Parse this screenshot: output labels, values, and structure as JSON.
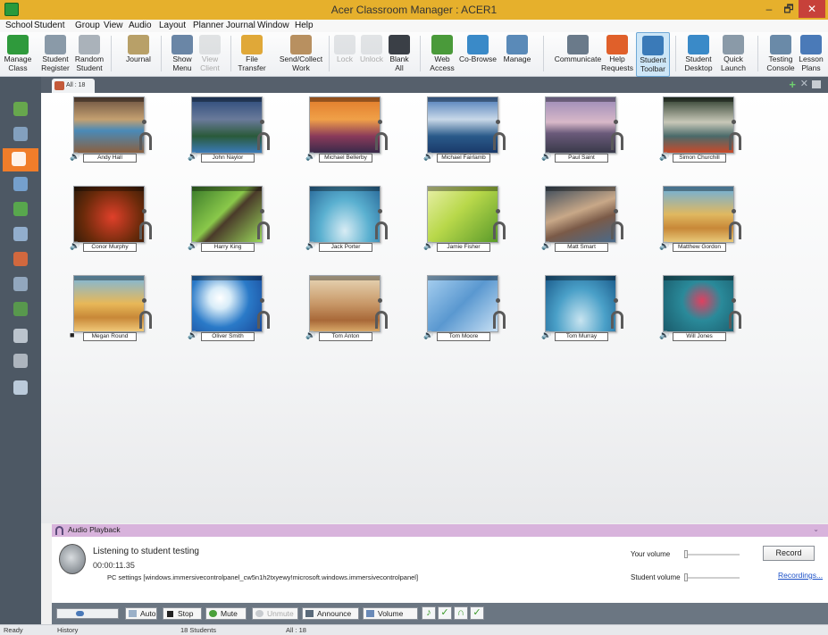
{
  "window": {
    "title": "Acer Classroom Manager : ACER1",
    "min": "–",
    "max": "🗗",
    "close": "✕"
  },
  "menu": [
    "School",
    "Student",
    "Group",
    "View",
    "Audio",
    "Layout",
    "Planner",
    "Journal",
    "Window",
    "Help"
  ],
  "ribbon": [
    {
      "label": "Manage\nClass",
      "icon": "manage-class-icon",
      "color": "#2f9a3c",
      "enabled": true
    },
    {
      "label": "Student\nRegister",
      "icon": "student-register-icon",
      "color": "#8a9aa8",
      "enabled": true
    },
    {
      "label": "Random\nStudent",
      "icon": "dice-icon",
      "color": "#aab2ba",
      "enabled": true
    },
    {
      "label": "Journal",
      "icon": "journal-icon",
      "color": "#b8a068",
      "enabled": true
    },
    {
      "label": "Show\nMenu",
      "icon": "show-icon",
      "color": "#6a86a6",
      "enabled": true
    },
    {
      "label": "View\nClient",
      "icon": "view-client-icon",
      "color": "#c6c9cc",
      "enabled": false
    },
    {
      "label": "File\nTransfer",
      "icon": "file-transfer-icon",
      "color": "#e0a838",
      "enabled": true
    },
    {
      "label": "Send/Collect\nWork",
      "icon": "send-collect-icon",
      "color": "#b89060",
      "enabled": true
    },
    {
      "label": "Lock",
      "icon": "lock-icon",
      "color": "#c8cbcf",
      "enabled": false
    },
    {
      "label": "Unlock",
      "icon": "unlock-icon",
      "color": "#c8cbcf",
      "enabled": false
    },
    {
      "label": "Blank\nAll",
      "icon": "blank-all-icon",
      "color": "#3a3f46",
      "enabled": true
    },
    {
      "label": "Web\nAccess",
      "icon": "web-access-icon",
      "color": "#4a9a3a",
      "enabled": true
    },
    {
      "label": "Co-Browse",
      "icon": "co-browse-icon",
      "color": "#3a8ac8",
      "enabled": true
    },
    {
      "label": "Manage",
      "icon": "manage-apps-icon",
      "color": "#5a8ab8",
      "enabled": true
    },
    {
      "label": "Communicate",
      "icon": "communicate-icon",
      "color": "#6a7a8a",
      "enabled": true
    },
    {
      "label": "Help\nRequests",
      "icon": "help-request-icon",
      "color": "#e0602a",
      "enabled": true
    },
    {
      "label": "Student\nToolbar",
      "icon": "student-toolbar-icon",
      "color": "#3a7ab8",
      "enabled": true,
      "active": true
    },
    {
      "label": "Student\nDesktop",
      "icon": "student-desktop-icon",
      "color": "#3a8ac8",
      "enabled": true
    },
    {
      "label": "Quick\nLaunch",
      "icon": "quick-launch-icon",
      "color": "#8a9aa8",
      "enabled": true
    },
    {
      "label": "Testing\nConsole",
      "icon": "testing-console-icon",
      "color": "#6a8aa8",
      "enabled": true
    },
    {
      "label": "Lesson\nPlans",
      "icon": "lesson-plans-icon",
      "color": "#4a7ab8",
      "enabled": true
    }
  ],
  "sidebar": [
    {
      "icon": "home-icon",
      "color": "#6ab04a"
    },
    {
      "icon": "grid-view-icon",
      "color": "#8aa8c8"
    },
    {
      "icon": "headphones-icon",
      "color": "#ffffff",
      "selected": true
    },
    {
      "icon": "question-icon",
      "color": "#7aa8d8"
    },
    {
      "icon": "globe-icon",
      "color": "#5ab04a"
    },
    {
      "icon": "window-icon",
      "color": "#9ab8d8"
    },
    {
      "icon": "pie-chart-icon",
      "color": "#e06a3a"
    },
    {
      "icon": "printer-icon",
      "color": "#9ab0c8"
    },
    {
      "icon": "users-icon",
      "color": "#5aa04a"
    },
    {
      "icon": "search-user-icon",
      "color": "#c8d0d8"
    },
    {
      "icon": "keyboard-icon",
      "color": "#b8c0c8"
    },
    {
      "icon": "trend-icon",
      "color": "#c8d8e8"
    }
  ],
  "tab": {
    "label": "All : 18",
    "add": "+",
    "close": "✕"
  },
  "students": [
    {
      "name": "Andy Hall",
      "bg": "linear-gradient(#6a5040,#c4a070 40%,#4a8ab8 60%,#8a6040)"
    },
    {
      "name": "John Naylor",
      "bg": "linear-gradient(#2a4a7a,#6a7a9a 40%,#2a5a3a 70%,#3a7ab8)"
    },
    {
      "name": "Michael Bellerby",
      "bg": "linear-gradient(#e07a2a,#f0a048 40%,#8a3a5a 70%,#3a2a4a)"
    },
    {
      "name": "Michael Fairlamb",
      "bg": "linear-gradient(#4a7ab8,#c8d8e8 40%,#2a5a8a 70%,#1a3a6a)"
    },
    {
      "name": "Paul Saint",
      "bg": "linear-gradient(#9a8ab8,#d8b8c8 45%,#6a5a7a 65%,#3a3a4a)"
    },
    {
      "name": "Simon Churchill",
      "bg": "linear-gradient(#2a3a2a,#c8c8b8 45%,#4a6a6a 70%,#c84a2a)"
    },
    {
      "name": "Conor Murphy",
      "bg": "radial-gradient(circle at 55% 55%,#e0402a,#6a2a0a 60%,#2a1a0a)"
    },
    {
      "name": "Harry King",
      "bg": "linear-gradient(135deg,#3a7a2a,#8ac84a 45%,#4a3a2a 55%,#9ad85a)"
    },
    {
      "name": "Jack Porter",
      "bg": "radial-gradient(ellipse at 50% 80%,#d8ecf4,#5ab0d0 50%,#2a6a9a)"
    },
    {
      "name": "Jamie Fisher",
      "bg": "linear-gradient(135deg,#e8f0a8,#b8d84a 45%,#5a9a2a)"
    },
    {
      "name": "Matt Smart",
      "bg": "linear-gradient(160deg,#3a4a5a,#c8a888 45%,#7a5a48 65%,#4a6a8a)"
    },
    {
      "name": "Matthew Gordon",
      "bg": "linear-gradient(#6ab0e0,#e0b860 50%,#c88838 75%,#e8c878)"
    },
    {
      "name": "Megan Round",
      "bg": "linear-gradient(#7ab8e0,#e8b858 50%,#c88838 75%,#f0c878)"
    },
    {
      "name": "Oliver Smith",
      "bg": "radial-gradient(circle at 40% 40%,#ffffff,#d8ecf8 20%,#2a7ac8 55%,#1a4a9a)"
    },
    {
      "name": "Tom Anton",
      "bg": "linear-gradient(#e8d8b8,#c89868 50%,#a86838 80%,#d8a868)"
    },
    {
      "name": "Tom Moore",
      "bg": "linear-gradient(135deg,#a8d0f0,#5a98d0 50%,#c8e0f4)"
    },
    {
      "name": "Tom Murray",
      "bg": "radial-gradient(ellipse at 50% 80%,#c8e4f0,#4aa0c8 50%,#1a5a8a)"
    },
    {
      "name": "Will Jones",
      "bg": "radial-gradient(circle at 55% 45%,#e04060,#2a8a9a 40%,#1a5a6a)"
    }
  ],
  "audio": {
    "title": "Audio Playback",
    "status": "Listening to student testing",
    "time": "00:00:11.35",
    "desc": "PC settings [windows.immersivecontrolpanel_cw5n1h2txyewy!microsoft.windows.immersivecontrolpanel]",
    "your_volume": "Your volume",
    "student_volume": "Student volume",
    "your_volume_level": 0.0,
    "student_volume_level": 0.0,
    "record": "Record",
    "recordings": "Recordings...",
    "collapse": "⌄"
  },
  "audiobar": {
    "auto": "Auto",
    "stop": "Stop",
    "mute": "Mute",
    "unmute": "Unmute",
    "announce": "Announce",
    "volume": "Volume",
    "seek_fraction": 0.35
  },
  "status": {
    "ready": "Ready",
    "history": "History",
    "students": "18 Students",
    "all": "All : 18"
  }
}
